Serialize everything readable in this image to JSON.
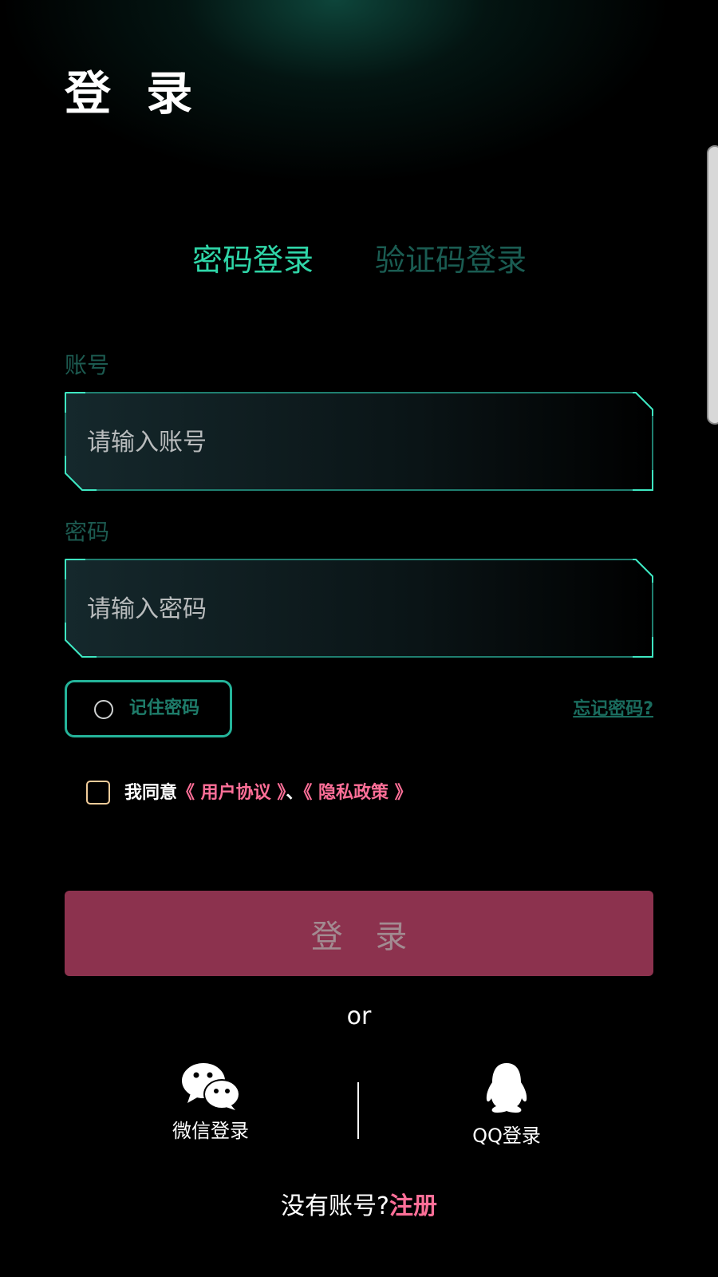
{
  "header": {
    "title": "登 录"
  },
  "tabs": [
    {
      "label": "密码登录",
      "active": true
    },
    {
      "label": "验证码登录",
      "active": false
    }
  ],
  "form": {
    "account": {
      "label": "账号",
      "placeholder": "请输入账号",
      "value": ""
    },
    "password": {
      "label": "密码",
      "placeholder": "请输入密码",
      "value": ""
    },
    "remember_label": "记住密码",
    "forgot_label": "忘记密码?",
    "agreement": {
      "prefix": "我同意",
      "user_agreement": "《 用户协议 》",
      "separator": "、",
      "privacy_policy": "《 隐私政策 》"
    },
    "login_label": "登 录"
  },
  "social": {
    "or_text": "or",
    "wechat_label": "微信登录",
    "qq_label": "QQ登录"
  },
  "footer": {
    "prompt": "没有账号?",
    "register_label": "注册"
  },
  "colors": {
    "accent_green": "#2fd6a8",
    "inactive_tab": "#1a5c52",
    "link_pink": "#ff6f98",
    "login_button": "#8c324e",
    "background": "#000000"
  }
}
